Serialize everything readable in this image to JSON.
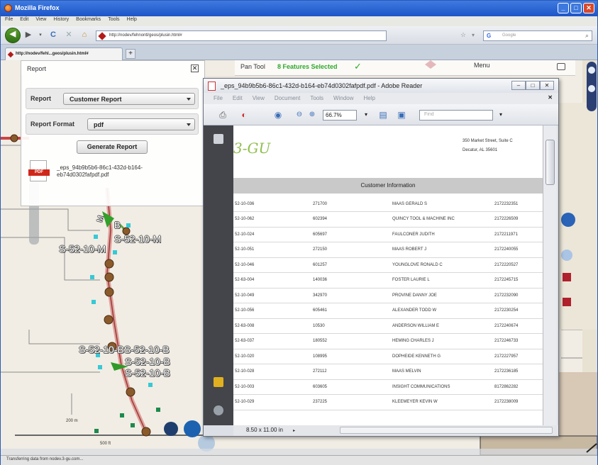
{
  "browser": {
    "window_title": "Mozilla Firefox",
    "menu": [
      "File",
      "Edit",
      "View",
      "History",
      "Bookmarks",
      "Tools",
      "Help"
    ],
    "url": "http://nodev/fehnontl/geos/plusin.html#",
    "search_placeholder": "Google",
    "tab_label": "http://nodev/fehl...geos/plusin.html#",
    "status": "Transferring data from nodev.3-gu.com..."
  },
  "map_toolbar": {
    "pan_tool": "Pan Tool",
    "features_selected": "8 Features Selected",
    "menu": "Menu"
  },
  "report_panel": {
    "title": "Report",
    "report_label": "Report",
    "report_value": "Customer Report",
    "format_label": "Report Format",
    "format_value": "pdf",
    "generate_button": "Generate Report",
    "pdf_icon_text": "PDF",
    "pdf_file": "_eps_94b9b5b6-86c1-432d-b164-eb74d0302fafpdf.pdf"
  },
  "map_labels": {
    "label1": "S-52-10-M",
    "label2": "S-52-10-M",
    "label3": "S-52-10-BS-52-10-B",
    "label4": "S-52-10-B",
    "label5": "S-52-10-B",
    "label6": "B",
    "label7": "M",
    "scale_m": "200 m",
    "scale_ft": "500 ft"
  },
  "reader": {
    "title": "_eps_94b9b5b6-86c1-432d-b164-eb74d0302fafpdf.pdf - Adobe Reader",
    "menu": [
      "File",
      "Edit",
      "View",
      "Document",
      "Tools",
      "Window",
      "Help"
    ],
    "zoom": "66.7%",
    "find_placeholder": "Find",
    "page_size": "8.50 x 11.00 in",
    "logo": "3-GU",
    "address_line1": "350 Market Street, Suite C",
    "address_line2": "Decatur, AL 35601",
    "section_header": "Customer Information",
    "rows": [
      [
        "52-10-036",
        "271700",
        "MAAS GERALD S",
        "2172232351"
      ],
      [
        "52-10-062",
        "602394",
        "QUINCY TOOL & MACHINE INC",
        "2172226509"
      ],
      [
        "52-10-024",
        "605697",
        "FAULCONER JUDITH",
        "2172211971"
      ],
      [
        "52-10-051",
        "272150",
        "MAAS ROBERT J",
        "2172240055"
      ],
      [
        "52-10-046",
        "601257",
        "YOUNGLOVE RONALD C",
        "2172220527"
      ],
      [
        "52-63-004",
        "140036",
        "FOSTER LAURIE L",
        "2172245715"
      ],
      [
        "52-10-049",
        "342970",
        "PROVINE DANNY JOE",
        "2172232090"
      ],
      [
        "52-10-056",
        "605461",
        "ALEXANDER TODD W",
        "2172230254"
      ],
      [
        "52-63-008",
        "10530",
        "ANDERSON WILLIAM E",
        "2172240674"
      ],
      [
        "52-63-037",
        "180552",
        "HEMING CHARLES J",
        "2172246733"
      ],
      [
        "52-10-020",
        "108995",
        "DOPHEIDE KENNETH G",
        "2172227957"
      ],
      [
        "52-10-028",
        "272112",
        "MAAS MELVIN",
        "2172236185"
      ],
      [
        "52-10-003",
        "603605",
        "INSIGHT COMMUNICATIONS",
        "8172862282"
      ],
      [
        "52-10-029",
        "237225",
        "KLEEMEYER KEVIN W",
        "2172238009"
      ]
    ]
  }
}
